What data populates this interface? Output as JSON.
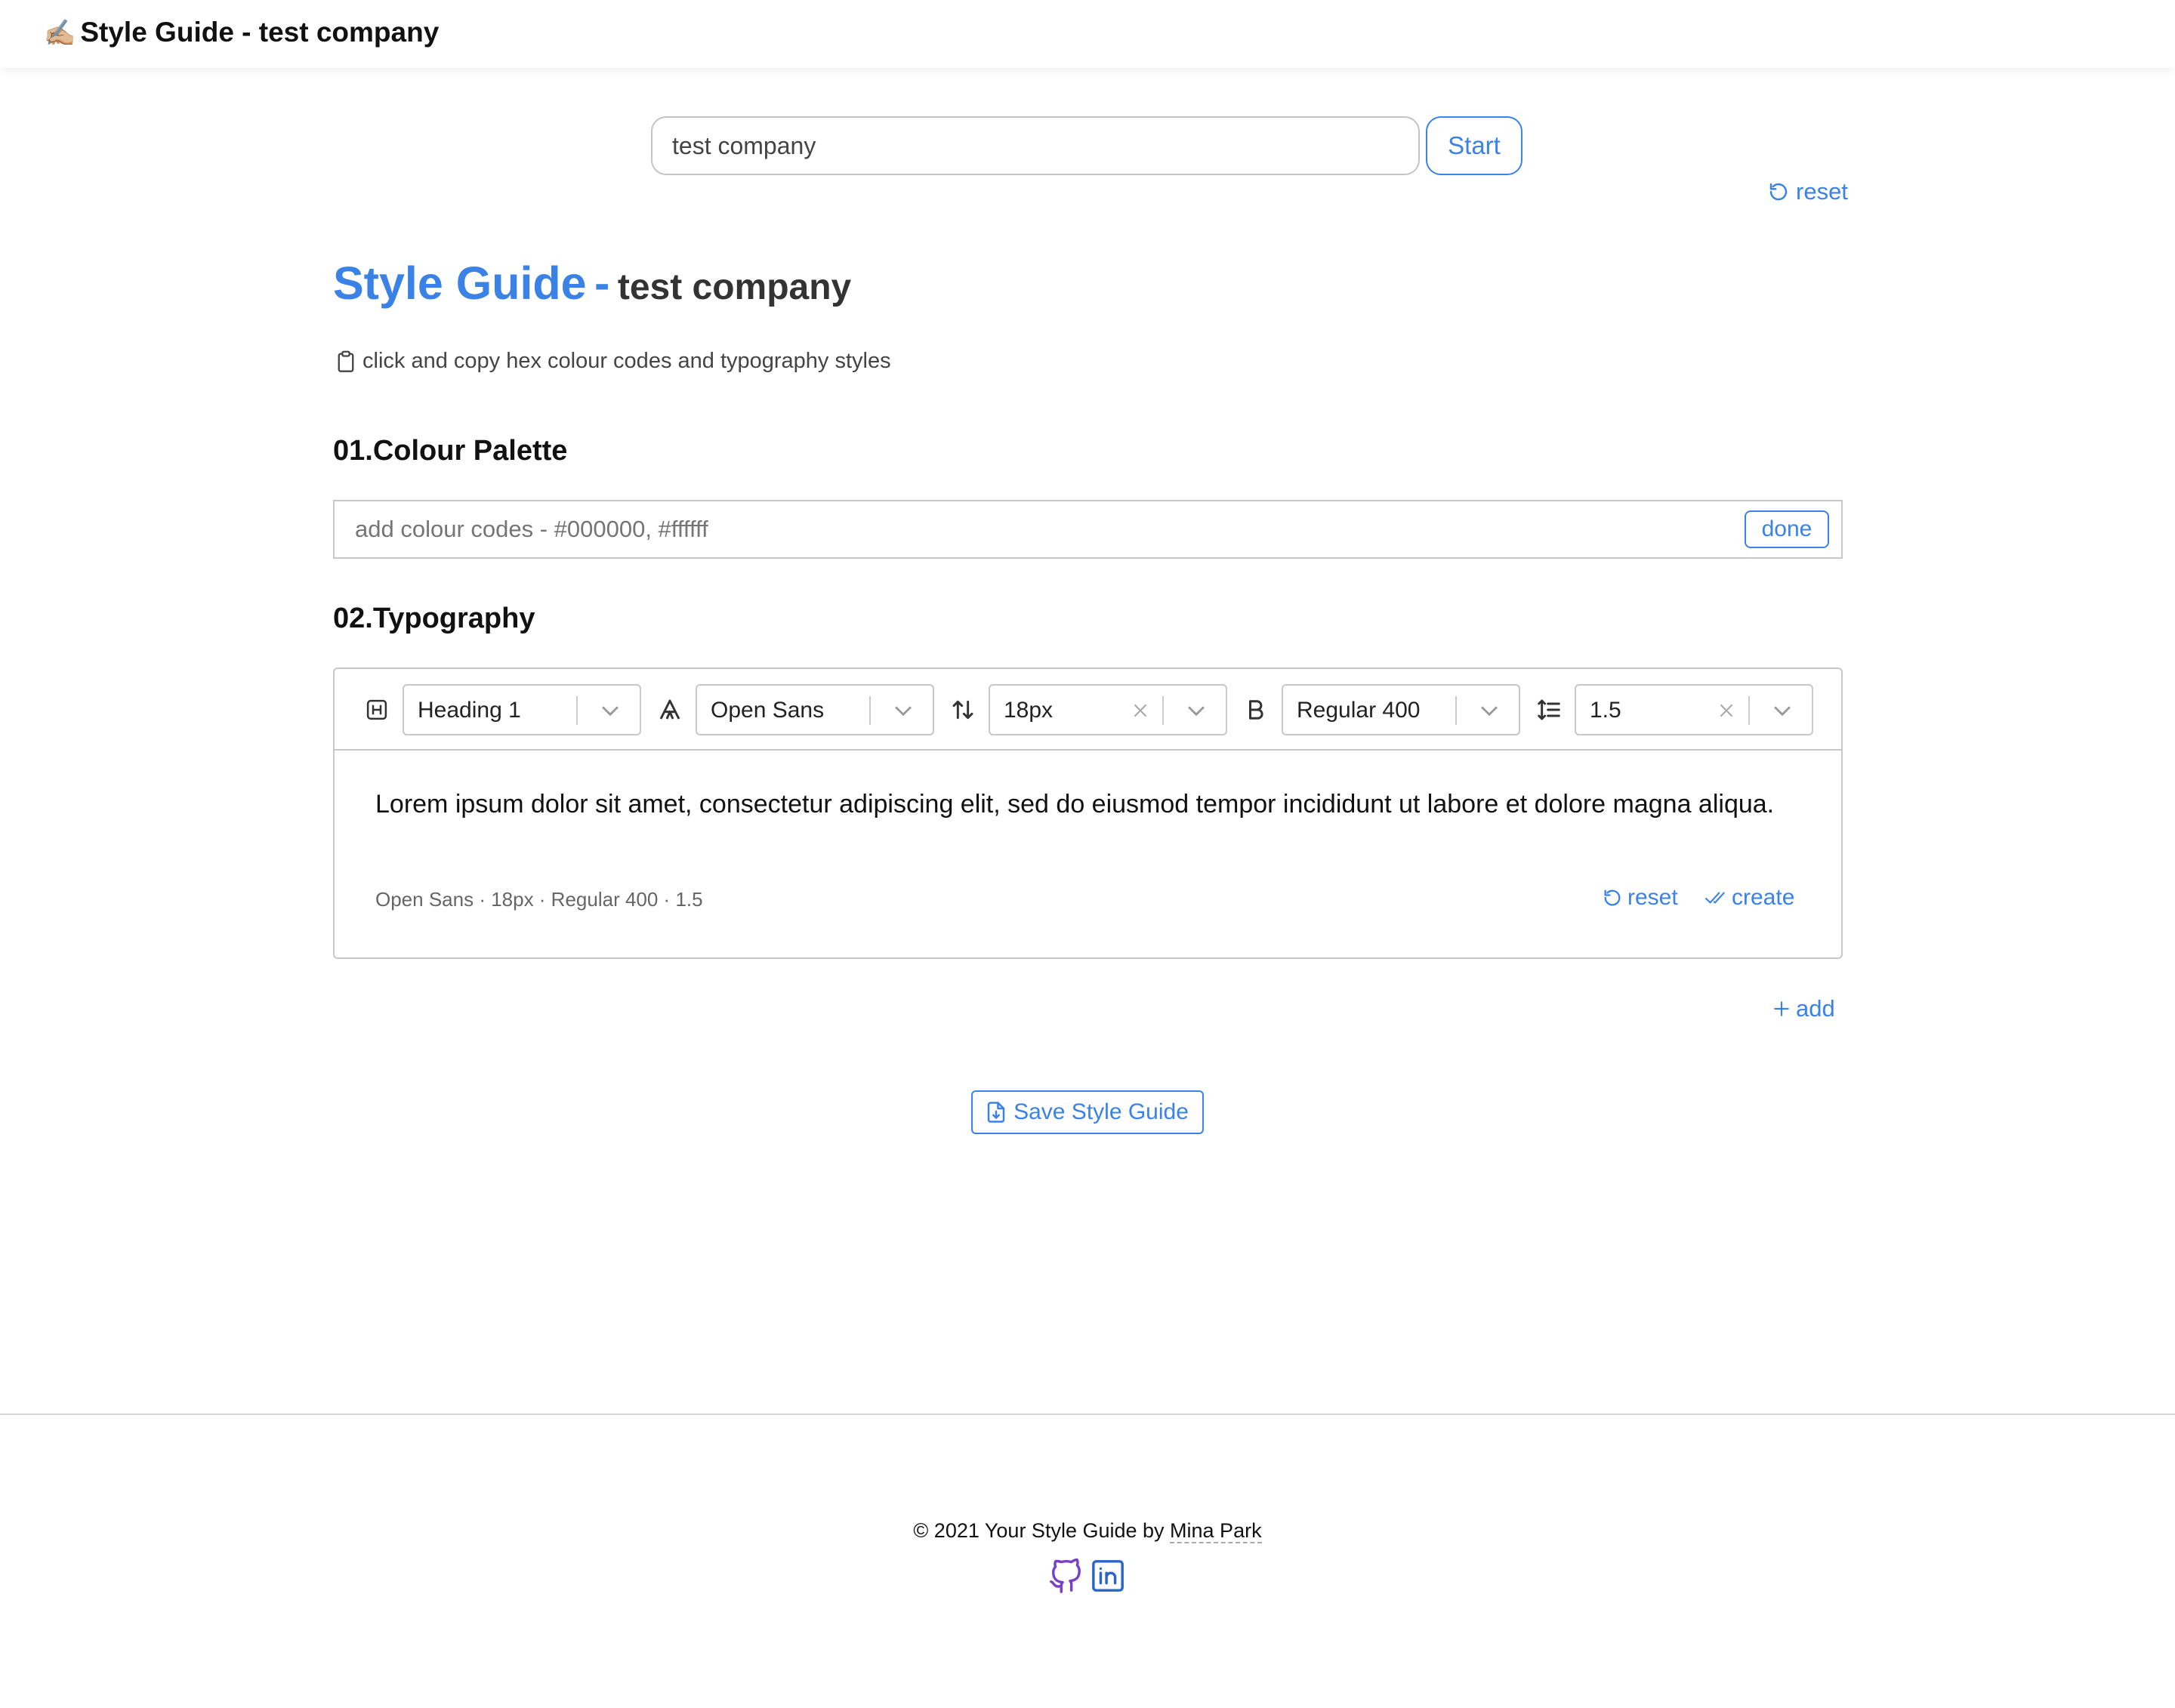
{
  "header": {
    "emoji": "✍🏼",
    "title": "Style Guide - test company"
  },
  "company_form": {
    "value": "test company",
    "start_label": "Start",
    "reset_label": "reset"
  },
  "heading": {
    "main": "Style Guide",
    "dash": "-",
    "company": "test company"
  },
  "hint": "click and copy hex colour codes and typography styles",
  "colour_palette": {
    "title": "01.Colour Palette",
    "placeholder": "add colour codes - #000000, #ffffff",
    "done_label": "done"
  },
  "typography": {
    "title": "02.Typography",
    "selects": {
      "heading": "Heading 1",
      "font": "Open Sans",
      "size": "18px",
      "weight": "Regular 400",
      "line_height": "1.5"
    },
    "sample_text": "Lorem ipsum dolor sit amet, consectetur adipiscing elit, sed do eiusmod tempor incididunt ut labore et dolore magna aliqua.",
    "meta": "Open Sans · 18px · Regular 400 · 1.5",
    "reset_label": "reset",
    "create_label": "create",
    "add_label": "add"
  },
  "save_label": "Save Style Guide",
  "footer": {
    "copyright_prefix": "© 2021 Your Style Guide by ",
    "author": "Mina Park"
  },
  "colors": {
    "accent": "#3b82e6",
    "github": "#7a3fc8",
    "linkedin": "#2a66c8"
  }
}
